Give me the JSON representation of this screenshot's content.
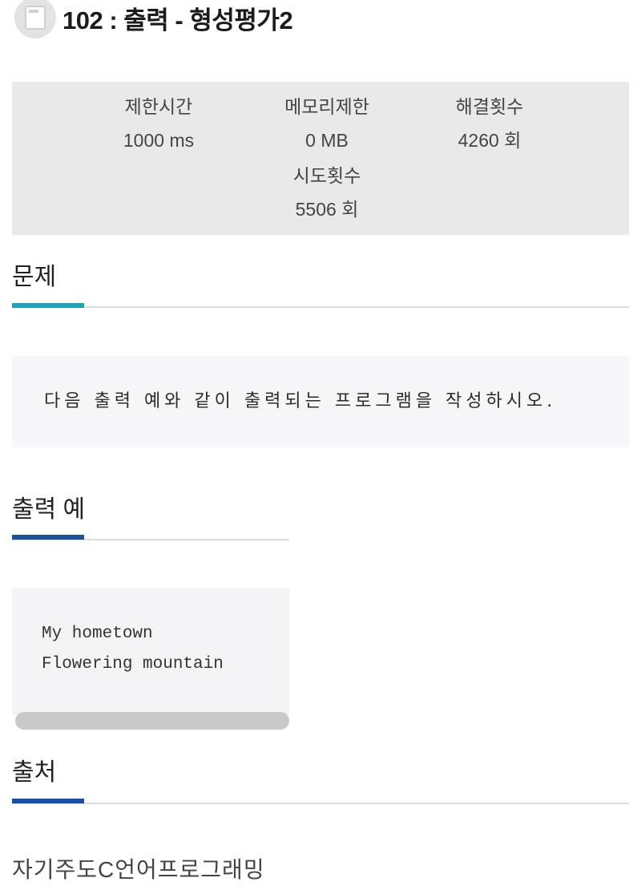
{
  "header": {
    "logo_icon": "book-icon",
    "title": "102 : 출력 - 형성평가2"
  },
  "stats": {
    "time_limit": {
      "label": "제한시간",
      "value": "1000 ms"
    },
    "memory_limit": {
      "label": "메모리제한",
      "value": "0 MB"
    },
    "solved_count": {
      "label": "해결횟수",
      "value": "4260 회"
    },
    "attempt_count": {
      "label": "시도횟수",
      "value": "5506 회"
    }
  },
  "problem": {
    "heading": "문제",
    "accent_color": "#1aa6b7",
    "text": "다음 출력 예와 같이 출력되는 프로그램을 작성하시오."
  },
  "output_example": {
    "heading": "출력 예",
    "accent_color": "#1a4fa8",
    "lines": [
      "My hometown",
      "Flowering mountain"
    ]
  },
  "source": {
    "heading": "출처",
    "accent_color": "#1a4fa8",
    "text": "자기주도C언어프로그래밍"
  }
}
